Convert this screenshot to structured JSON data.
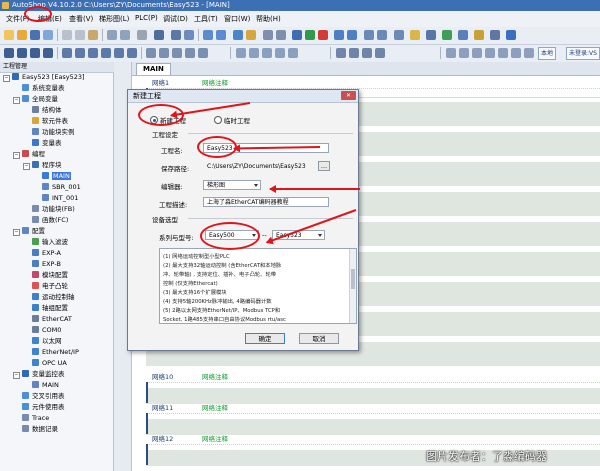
{
  "window": {
    "title": "AutoShop V4.10.2.0  C:\\Users\\ZY\\Documents\\Easy523 - [MAIN]"
  },
  "menu": {
    "items": [
      "文件(F)",
      "编辑(E)",
      "查看(V)",
      "梯形图(L)",
      "PLC(P)",
      "调试(D)",
      "工具(T)",
      "窗口(W)",
      "帮助(H)"
    ]
  },
  "toolbar": {
    "local_label": "本地",
    "status_label": "未登录:VS"
  },
  "project_panel": {
    "header": "工程管理",
    "items": [
      {
        "label": "Easy523 [Easy523]"
      },
      {
        "label": "系统变量表"
      },
      {
        "label": "全局变量"
      },
      {
        "label": "结构体"
      },
      {
        "label": "软元件表"
      },
      {
        "label": "功能块实例"
      },
      {
        "label": "变量表"
      },
      {
        "label": "编程"
      },
      {
        "label": "程序块"
      },
      {
        "label": "MAIN"
      },
      {
        "label": "SBR_001"
      },
      {
        "label": "INT_001"
      },
      {
        "label": "功能块(FB)"
      },
      {
        "label": "函数(FC)"
      },
      {
        "label": "配置"
      },
      {
        "label": "输入滤波"
      },
      {
        "label": "EXP-A"
      },
      {
        "label": "EXP-B"
      },
      {
        "label": "模块配置"
      },
      {
        "label": "电子凸轮"
      },
      {
        "label": "运动控制轴"
      },
      {
        "label": "轴组配置"
      },
      {
        "label": "EtherCAT"
      },
      {
        "label": "COM0"
      },
      {
        "label": "以太网"
      },
      {
        "label": "EtherNet/IP"
      },
      {
        "label": "OPC UA"
      },
      {
        "label": "变量监控表"
      },
      {
        "label": "MAIN"
      },
      {
        "label": "交叉引用表"
      },
      {
        "label": "元件使用表"
      },
      {
        "label": "Trace"
      },
      {
        "label": "数据记录"
      }
    ]
  },
  "editor": {
    "tab": "MAIN",
    "rungs": [
      {
        "num": "网络1",
        "comment": "网络注释"
      },
      {
        "num": "网络10",
        "comment": "网络注释"
      },
      {
        "num": "网络11",
        "comment": "网络注释"
      },
      {
        "num": "网络12",
        "comment": "网络注释"
      }
    ]
  },
  "dialog": {
    "title": "新建工程",
    "close_label": "✕",
    "radio_new": "新建工程",
    "radio_temp": "临时工程",
    "group_project": "工程设定",
    "name_label": "工程名:",
    "name_value": "Easy523",
    "path_label": "保存路径:",
    "path_value": "C:\\Users\\ZY\\Documents\\Easy523",
    "browse_label": "...",
    "editor_label": "编辑器:",
    "editor_value": "梯形图",
    "desc_label": "工程描述:",
    "desc_value": "上海了淼EtherCAT编码器教程",
    "group_device": "设备选型",
    "series_label": "系列与型号:",
    "series_value": "Easy500",
    "dash": "--",
    "model_value": "Easy523",
    "description_lines": [
      "(1) 网络运动控制型小型PLC",
      "(2) 最大支持32轴运动控制 (含EtherCAT和本地脉",
      "冲、轮带轴) , 支持定位、插补、电子凸轮、轮带",
      "控制 (仅支持Ethercat)",
      "(3) 最大支持16个扩展模块",
      "(4) 支持5轴200KHz脉冲输出, 4路编码器计数",
      "(5) 2路以太网支持EtherNet/IP、Modbus TCP和",
      "Socket, 1路485支持串口自由协议Modbus rtu/asc"
    ],
    "ok_label": "确定",
    "cancel_label": "取消"
  },
  "watermark": "图片发布者：了淼编码器",
  "colors": {
    "annotation_red": "#e0141c",
    "comment_green": "#0a9a28",
    "selection_blue": "#3b78d8"
  }
}
